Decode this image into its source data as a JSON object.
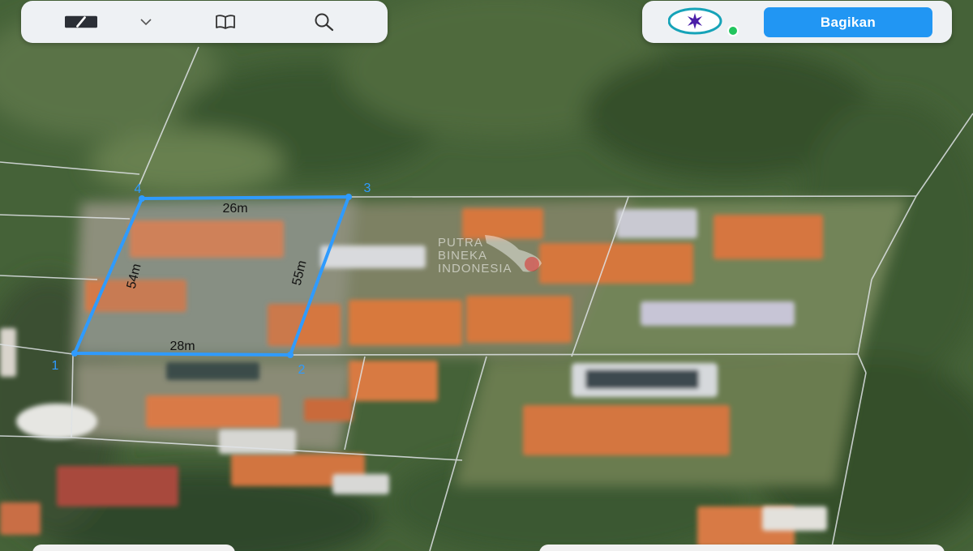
{
  "toolbar": {
    "icons": [
      "pencil-icon",
      "chevron-down-icon",
      "book-icon",
      "search-icon"
    ]
  },
  "share": {
    "label": "Bagikan",
    "color": "#2196f3"
  },
  "plot": {
    "line_color": "#2f9bff",
    "sides": {
      "top": "26m",
      "right": "55m",
      "bottom": "28m",
      "left": "54m"
    },
    "vertices": [
      "1",
      "2",
      "3",
      "4"
    ]
  },
  "watermark": {
    "line1": "PUTRA",
    "line2": "BINEKA",
    "line3": "INDONESIA"
  },
  "colors": {
    "roof": "#d9773f",
    "vegetation": "#3e5c32",
    "accent": "#2196f3",
    "status_green": "#22c55e"
  }
}
